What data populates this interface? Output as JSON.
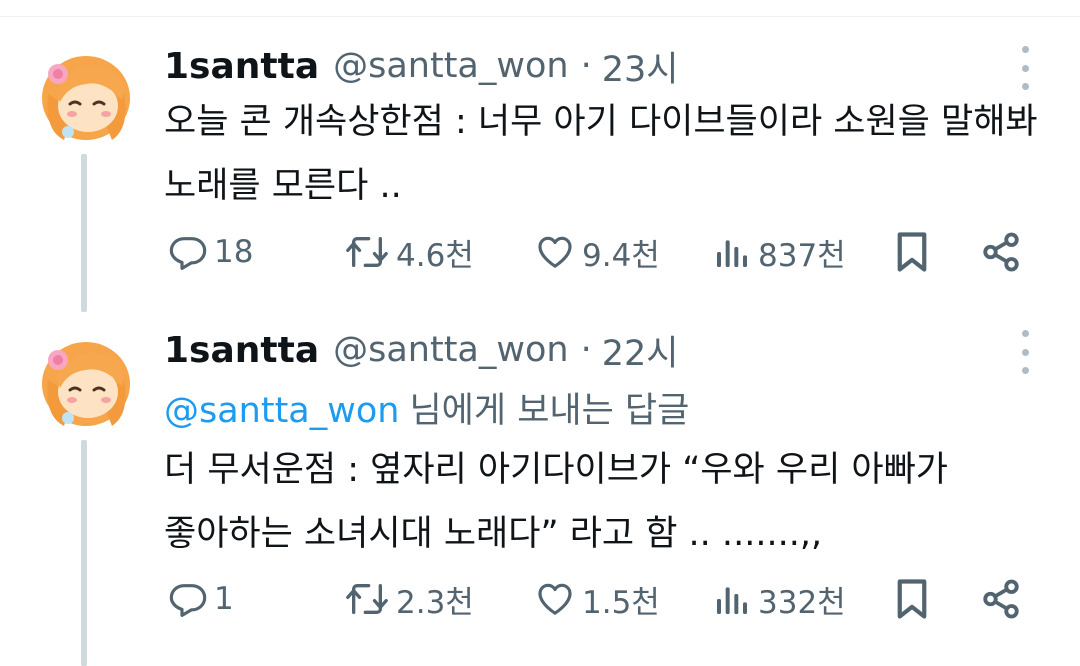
{
  "tweets": [
    {
      "display_name": "1santta",
      "handle": "@santta_won",
      "separator": "·",
      "time": "23시",
      "reply_to": null,
      "body_lines": [
        "오늘 콘 개속상한점 : 너무 아기 다이브들이라 소원을 말해봐",
        "노래를 모른다 .."
      ],
      "stats": {
        "replies": "18",
        "retweets": "4.6천",
        "likes": "9.4천",
        "views": "837천"
      }
    },
    {
      "display_name": "1santta",
      "handle": "@santta_won",
      "separator": "·",
      "time": "22시",
      "reply_to": {
        "mention": "@santta_won",
        "suffix": "님에게 보내는 답글"
      },
      "body_lines": [
        "더 무서운점 : 옆자리 아기다이브가 “우와 우리 아빠가",
        "좋아하는 소녀시대 노래다” 라고 함 .. .......,,"
      ],
      "stats": {
        "replies": "1",
        "retweets": "2.3천",
        "likes": "1.5천",
        "views": "332천"
      }
    }
  ],
  "icons": {
    "more": "more-vertical-icon",
    "reply": "reply-icon",
    "retweet": "retweet-icon",
    "like": "heart-icon",
    "views": "views-icon",
    "bookmark": "bookmark-icon",
    "share": "share-icon"
  },
  "colors": {
    "text": "#0f1419",
    "secondary": "#536471",
    "link": "#1d9bf0",
    "thread_line": "#cfd9de"
  }
}
